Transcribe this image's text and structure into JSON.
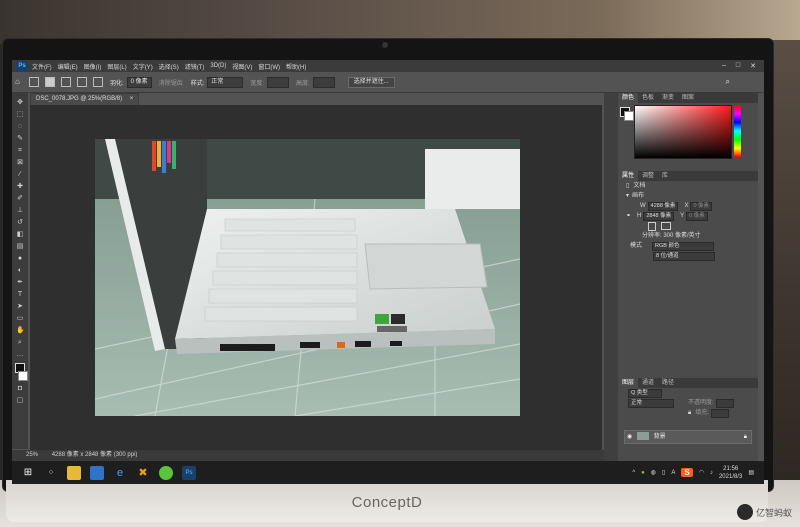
{
  "photoshop": {
    "logo": "Ps",
    "menu": [
      "文件(F)",
      "编辑(E)",
      "图像(I)",
      "图层(L)",
      "文字(Y)",
      "选择(S)",
      "滤镜(T)",
      "3D(D)",
      "视图(V)",
      "窗口(W)",
      "帮助(H)"
    ],
    "options": {
      "feather_label": "羽化:",
      "feather_value": "0 像素",
      "antialias_label": "消除锯齿",
      "style_label": "样式:",
      "style_value": "正常",
      "width_label": "宽度:",
      "height_label": "高度:",
      "select_mask_button": "选择并遮住..."
    },
    "document_tab": "DSC_0078.JPG @ 25%(RGB/8)",
    "status": {
      "zoom": "25%",
      "info": "4288 像素 x 2848 像素 (300 ppi)"
    },
    "color_panel": {
      "tabs": [
        "颜色",
        "色板",
        "渐变",
        "图案"
      ]
    },
    "properties_panel": {
      "tabs": [
        "属性",
        "调整",
        "库"
      ],
      "doc_label": "文档",
      "canvas_label": "画布",
      "w_label": "W",
      "w_value": "4288 像素",
      "x_label": "X",
      "x_placeholder": "0 像素",
      "h_label": "H",
      "h_value": "2848 像素",
      "y_label": "Y",
      "y_placeholder": "0 像素",
      "resolution": "分辨率: 300 像素/英寸",
      "mode_label": "模式",
      "mode_value": "RGB 颜色",
      "depth_value": "8 位/通道"
    },
    "layers_panel": {
      "tabs": [
        "图层",
        "通道",
        "路径"
      ],
      "kind_label": "Q 类型",
      "blend_value": "正常",
      "opacity_label": "不透明度:",
      "fill_label": "填充:",
      "layer_name": "背景"
    }
  },
  "taskbar": {
    "time": "21:56",
    "date": "2021/8/3",
    "ime": "S",
    "lang": "A"
  },
  "monitor_brand": "ConceptD",
  "watermark": "亿智蚂蚁"
}
